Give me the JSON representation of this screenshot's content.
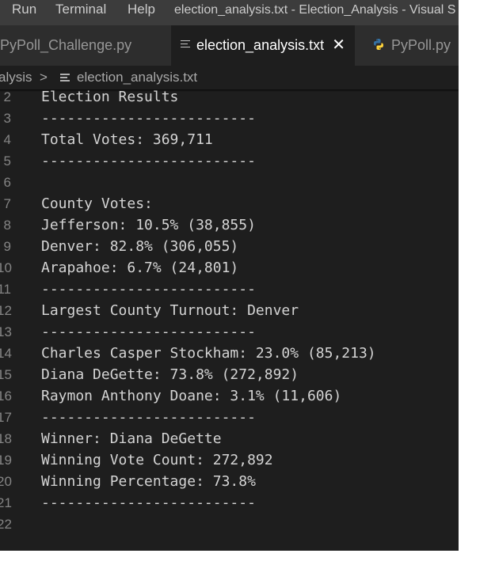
{
  "menubar": {
    "items": [
      "Run",
      "Terminal",
      "Help"
    ],
    "window_title": "election_analysis.txt - Election_Analysis - Visual S"
  },
  "tabs": [
    {
      "label": "PyPoll_Challenge.py",
      "active": false,
      "icon": "none"
    },
    {
      "label": "election_analysis.txt",
      "active": true,
      "icon": "text-file-icon",
      "close": "✕"
    },
    {
      "label": "PyPoll.py",
      "active": false,
      "icon": "python-icon"
    }
  ],
  "breadcrumb": {
    "folder": "alysis",
    "separator": ">",
    "file": "election_analysis.txt"
  },
  "editor": {
    "lines": [
      {
        "number": "2",
        "text": "Election Results"
      },
      {
        "number": "3",
        "text": "-------------------------"
      },
      {
        "number": "4",
        "text": "Total Votes: 369,711"
      },
      {
        "number": "5",
        "text": "-------------------------"
      },
      {
        "number": "6",
        "text": ""
      },
      {
        "number": "7",
        "text": "County Votes:"
      },
      {
        "number": "8",
        "text": "Jefferson: 10.5% (38,855)"
      },
      {
        "number": "9",
        "text": "Denver: 82.8% (306,055)"
      },
      {
        "number": "10",
        "text": "Arapahoe: 6.7% (24,801)"
      },
      {
        "number": "11",
        "text": "-------------------------"
      },
      {
        "number": "12",
        "text": "Largest County Turnout: Denver"
      },
      {
        "number": "13",
        "text": "-------------------------"
      },
      {
        "number": "14",
        "text": "Charles Casper Stockham: 23.0% (85,213)"
      },
      {
        "number": "15",
        "text": "Diana DeGette: 73.8% (272,892)"
      },
      {
        "number": "16",
        "text": "Raymon Anthony Doane: 3.1% (11,606)"
      },
      {
        "number": "17",
        "text": "-------------------------"
      },
      {
        "number": "18",
        "text": "Winner: Diana DeGette"
      },
      {
        "number": "19",
        "text": "Winning Vote Count: 272,892"
      },
      {
        "number": "20",
        "text": "Winning Percentage: 73.8%"
      },
      {
        "number": "21",
        "text": "-------------------------"
      },
      {
        "number": "22",
        "text": ""
      }
    ]
  },
  "colors": {
    "editor_bg": "#1e1e1e",
    "titlebar_bg": "#3c3c3c",
    "tabbar_bg": "#252526",
    "text": "#d4d4d4",
    "line_number": "#858585",
    "python_blue": "#3572A5",
    "python_yellow": "#FFD43B"
  }
}
